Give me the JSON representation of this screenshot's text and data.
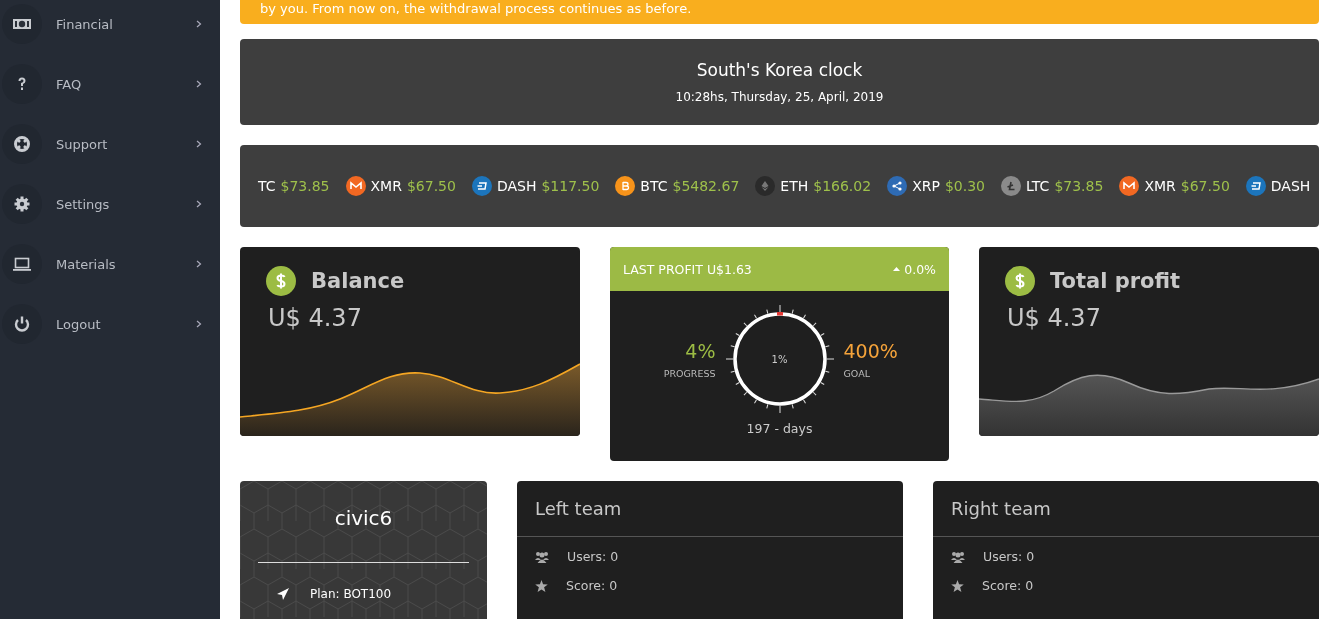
{
  "sidebar": {
    "items": [
      {
        "label": "Financial",
        "kind": "money"
      },
      {
        "label": "FAQ",
        "kind": "question"
      },
      {
        "label": "Support",
        "kind": "lifebuoy"
      },
      {
        "label": "Settings",
        "kind": "gear"
      },
      {
        "label": "Materials",
        "kind": "laptop"
      },
      {
        "label": "Logout",
        "kind": "power"
      }
    ]
  },
  "notice": {
    "text": "by you. From now on, the withdrawal process continues as before."
  },
  "clock": {
    "title": "South's Korea clock",
    "time": "10:28hs, Thursday, 25, April, 2019"
  },
  "ticker": [
    {
      "kind": "none",
      "symbol": "TC",
      "price": "$73.85"
    },
    {
      "kind": "xmr",
      "symbol": "XMR",
      "price": "$67.50"
    },
    {
      "kind": "dash",
      "symbol": "DASH",
      "price": "$117.50"
    },
    {
      "kind": "btc",
      "symbol": "BTC",
      "price": "$5482.67"
    },
    {
      "kind": "eth",
      "symbol": "ETH",
      "price": "$166.02"
    },
    {
      "kind": "xrp",
      "symbol": "XRP",
      "price": "$0.30"
    },
    {
      "kind": "ltc",
      "symbol": "LTC",
      "price": "$73.85"
    },
    {
      "kind": "xmr",
      "symbol": "XMR",
      "price": "$67.50"
    },
    {
      "kind": "dash",
      "symbol": "DASH"
    }
  ],
  "balance": {
    "title": "Balance",
    "amount": "U$ 4.37"
  },
  "profit_card": {
    "title": "LAST PROFIT U$1.63",
    "change": "0.0%",
    "progress": "4%",
    "progress_label": "PROGRESS",
    "center": "1%",
    "goal": "400%",
    "goal_label": "GOAL",
    "days": "197 - days"
  },
  "total_profit": {
    "title": "Total profit",
    "amount": "U$ 4.37"
  },
  "user_card": {
    "name": "civic6",
    "plan": "Plan: BOT100"
  },
  "teams": [
    {
      "title": "Left team",
      "users": "Users: 0",
      "score": "Score: 0"
    },
    {
      "title": "Right team",
      "users": "Users: 0",
      "score": "Score: 0"
    }
  ]
}
